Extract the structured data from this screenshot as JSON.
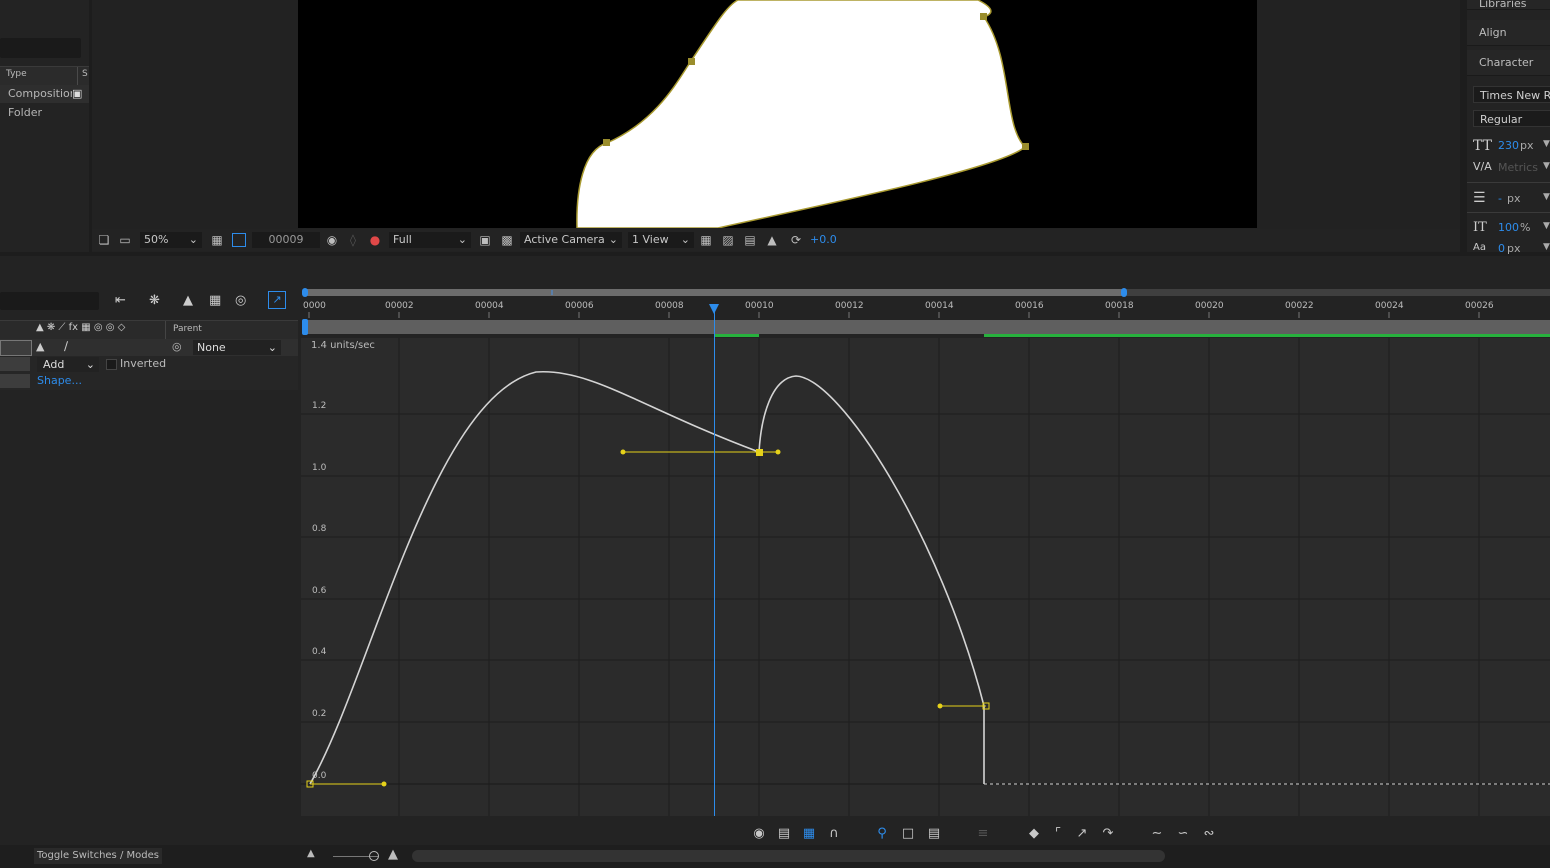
{
  "project": {
    "col_type": "Type",
    "col_extra": "S",
    "rows": [
      "Composition",
      "Folder"
    ]
  },
  "viewer_toolbar": {
    "zoom": "50%",
    "timecode": "00009",
    "resolution": "Full",
    "camera": "Active Camera",
    "views": "1 View",
    "exposure": "+0.0"
  },
  "right_panel": {
    "tabs": [
      "Libraries",
      "Align",
      "Character"
    ],
    "font": "Times New Roman",
    "style": "Regular",
    "size_value": "230",
    "size_unit": "px",
    "kerning": "Metrics",
    "leading_value": "-",
    "leading_unit": "px",
    "vscale_value": "100",
    "vscale_unit": "%",
    "baseline_value": "0",
    "baseline_unit": "px"
  },
  "timeline": {
    "col_parent": "Parent",
    "parent_value": "None",
    "mask_mode": "Add",
    "inverted_label": "Inverted",
    "shape_link": "Shape...",
    "ruler_labels": [
      "0000",
      "00002",
      "00004",
      "00006",
      "00008",
      "00010",
      "00012",
      "00014",
      "00016",
      "00018",
      "00020",
      "00022",
      "00024",
      "00026"
    ],
    "current_frame": "00009"
  },
  "graph": {
    "unit_label": "1.4 units/sec",
    "y_labels": [
      "1.2",
      "1.0",
      "0.8",
      "0.6",
      "0.4",
      "0.2",
      "0.0"
    ]
  },
  "footer": {
    "toggle_label": "Toggle Switches / Modes"
  },
  "colors": {
    "accent": "#2d8ceb",
    "keyframe": "#e6d21a",
    "green_bar": "#27b13d"
  }
}
